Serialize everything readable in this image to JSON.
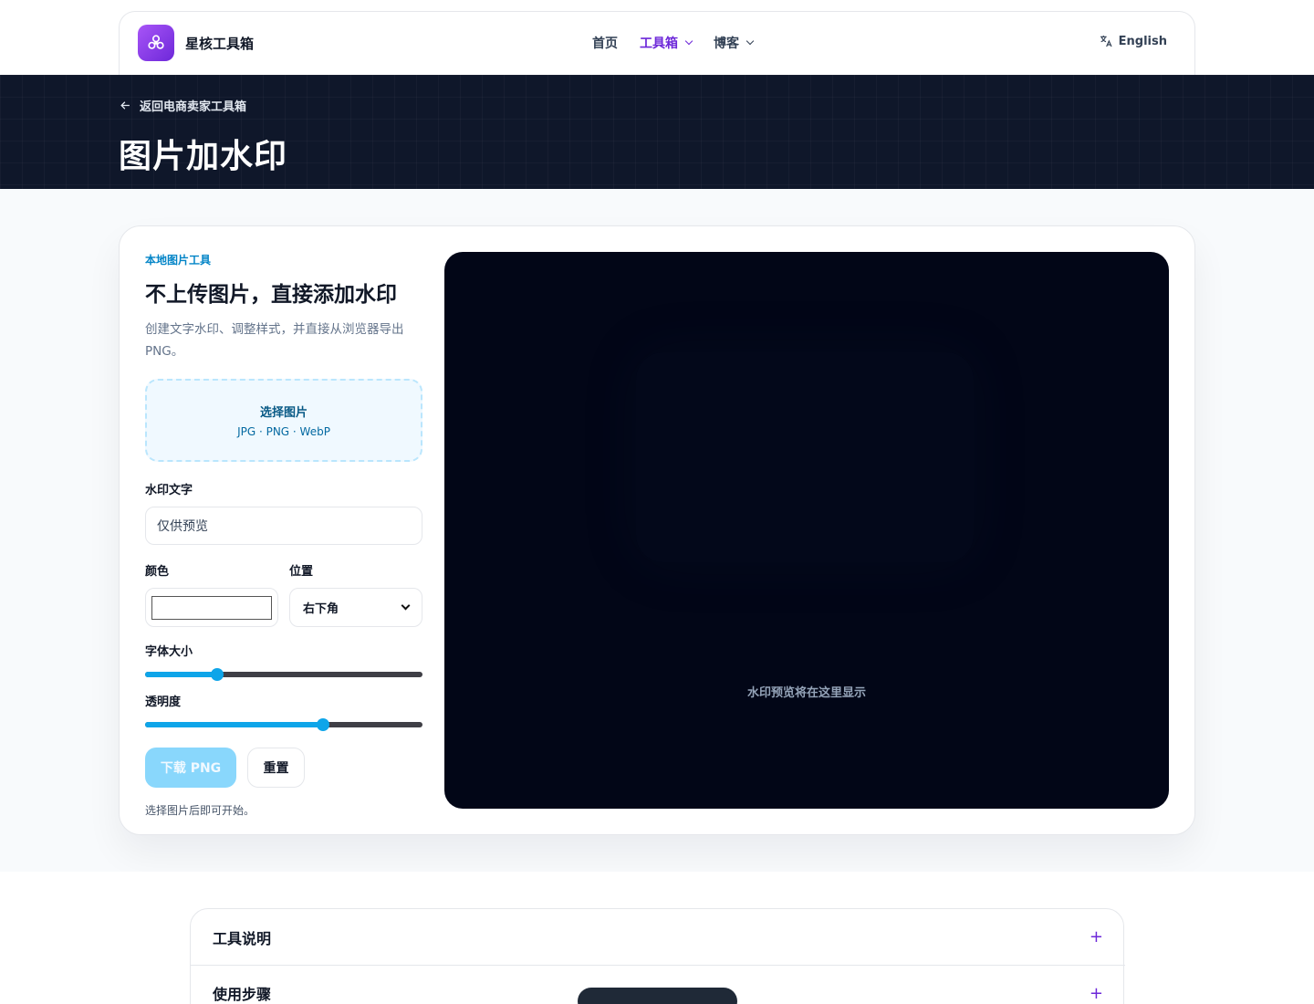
{
  "brand": {
    "name": "星核工具箱",
    "logo_icon": "molecule-icon"
  },
  "nav": {
    "items": [
      {
        "label": "首页",
        "active": false,
        "dropdown": false
      },
      {
        "label": "工具箱",
        "active": true,
        "dropdown": true
      },
      {
        "label": "博客",
        "active": false,
        "dropdown": true
      }
    ],
    "language": "English"
  },
  "hero": {
    "back_label": "返回电商卖家工具箱",
    "title": "图片加水印"
  },
  "tool": {
    "kicker": "本地图片工具",
    "heading": "不上传图片，直接添加水印",
    "description": "创建文字水印、调整样式，并直接从浏览器导出 PNG。",
    "dropzone": {
      "title": "选择图片",
      "formats": "JPG · PNG · WebP"
    },
    "watermark_text_label": "水印文字",
    "watermark_text_value": "仅供预览",
    "color_label": "颜色",
    "color_value": "#ffffff",
    "position_label": "位置",
    "position_value": "右下角",
    "font_size_label": "字体大小",
    "font_size_fraction": 0.26,
    "opacity_label": "透明度",
    "opacity_fraction": 0.64,
    "download_label": "下载 PNG",
    "reset_label": "重置",
    "hint": "选择图片后即可开始。"
  },
  "preview": {
    "placeholder": "水印预览将在这里显示"
  },
  "accordion": [
    {
      "title": "工具说明"
    },
    {
      "title": "使用步骤"
    }
  ],
  "colors": {
    "accent": "#6d28d9",
    "primary_blue": "#0ea5e9",
    "hero_bg": "#0f172a",
    "preview_bg": "#020617"
  }
}
